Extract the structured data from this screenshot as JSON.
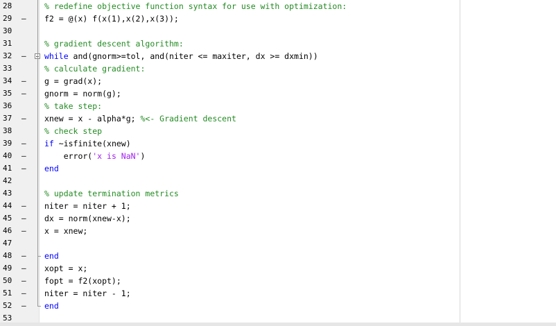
{
  "editor": {
    "lines": [
      {
        "num": "28",
        "bp": "",
        "tokens": [
          {
            "t": "% redefine objective function syntax for use with optimization:",
            "c": "comment"
          }
        ]
      },
      {
        "num": "29",
        "bp": "–",
        "tokens": [
          {
            "t": "f2 = @(x) f(x(1),x(2),x(3));",
            "c": "plain"
          }
        ]
      },
      {
        "num": "30",
        "bp": "",
        "tokens": []
      },
      {
        "num": "31",
        "bp": "",
        "tokens": [
          {
            "t": "% gradient descent algorithm:",
            "c": "comment"
          }
        ]
      },
      {
        "num": "32",
        "bp": "–",
        "tokens": [
          {
            "t": "while",
            "c": "keyword"
          },
          {
            "t": " and(gnorm>=tol, and(niter <= maxiter, dx >= dxmin))",
            "c": "plain"
          }
        ]
      },
      {
        "num": "33",
        "bp": "",
        "tokens": [
          {
            "t": "% calculate gradient:",
            "c": "comment"
          }
        ]
      },
      {
        "num": "34",
        "bp": "–",
        "tokens": [
          {
            "t": "g = grad(x);",
            "c": "plain"
          }
        ]
      },
      {
        "num": "35",
        "bp": "–",
        "tokens": [
          {
            "t": "gnorm = norm(g);",
            "c": "plain"
          }
        ]
      },
      {
        "num": "36",
        "bp": "",
        "tokens": [
          {
            "t": "% take step:",
            "c": "comment"
          }
        ]
      },
      {
        "num": "37",
        "bp": "–",
        "tokens": [
          {
            "t": "xnew = x - alpha*g; ",
            "c": "plain"
          },
          {
            "t": "%<- Gradient descent",
            "c": "comment"
          }
        ]
      },
      {
        "num": "38",
        "bp": "",
        "tokens": [
          {
            "t": "% check step",
            "c": "comment"
          }
        ]
      },
      {
        "num": "39",
        "bp": "–",
        "tokens": [
          {
            "t": "if",
            "c": "keyword"
          },
          {
            "t": " ~isfinite(xnew)",
            "c": "plain"
          }
        ]
      },
      {
        "num": "40",
        "bp": "–",
        "tokens": [
          {
            "t": "    error(",
            "c": "plain"
          },
          {
            "t": "'x is NaN'",
            "c": "string"
          },
          {
            "t": ")",
            "c": "plain"
          }
        ]
      },
      {
        "num": "41",
        "bp": "–",
        "tokens": [
          {
            "t": "end",
            "c": "keyword"
          }
        ]
      },
      {
        "num": "42",
        "bp": "",
        "tokens": []
      },
      {
        "num": "43",
        "bp": "",
        "tokens": [
          {
            "t": "% update termination metrics",
            "c": "comment"
          }
        ]
      },
      {
        "num": "44",
        "bp": "–",
        "tokens": [
          {
            "t": "niter = niter + 1;",
            "c": "plain"
          }
        ]
      },
      {
        "num": "45",
        "bp": "–",
        "tokens": [
          {
            "t": "dx = norm(xnew-x);",
            "c": "plain"
          }
        ]
      },
      {
        "num": "46",
        "bp": "–",
        "tokens": [
          {
            "t": "x = xnew;",
            "c": "plain"
          }
        ]
      },
      {
        "num": "47",
        "bp": "",
        "tokens": []
      },
      {
        "num": "48",
        "bp": "–",
        "tokens": [
          {
            "t": "end",
            "c": "keyword"
          }
        ]
      },
      {
        "num": "49",
        "bp": "–",
        "tokens": [
          {
            "t": "xopt = x;",
            "c": "plain"
          }
        ]
      },
      {
        "num": "50",
        "bp": "–",
        "tokens": [
          {
            "t": "fopt = f2(xopt);",
            "c": "plain"
          }
        ]
      },
      {
        "num": "51",
        "bp": "–",
        "tokens": [
          {
            "t": "niter = niter - 1;",
            "c": "plain"
          }
        ]
      },
      {
        "num": "52",
        "bp": "–",
        "tokens": [
          {
            "t": "end",
            "c": "keyword"
          }
        ]
      },
      {
        "num": "53",
        "bp": "",
        "tokens": []
      }
    ]
  },
  "colors": {
    "comment": "#228b22",
    "keyword": "#0000ff",
    "string": "#a020f0",
    "plain": "#000000",
    "gutter": "#f0f0f0"
  }
}
